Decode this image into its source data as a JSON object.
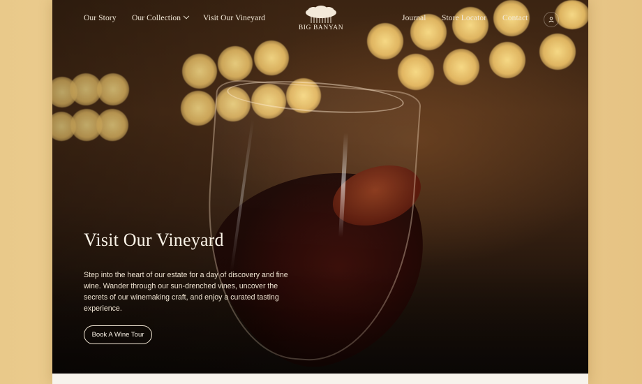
{
  "nav": {
    "left_links": [
      "Our Story",
      "Our Collection",
      "Visit Our Vineyard"
    ],
    "right_links": [
      "Journal",
      "Store Locator",
      "Contact"
    ],
    "logo_text": "BIG BANYAN",
    "icons": {
      "dropdown": "chevron-down-icon",
      "account": "user-icon",
      "logo": "banyan-tree-logo"
    }
  },
  "hero": {
    "title": "Visit Our Vineyard",
    "description": "Step into the heart of our estate for a day of discovery and fine wine. Wander through our sun-drenched vines, uncover the secrets of our winemaking craft, and enjoy a curated tasting experience.",
    "cta_label": "Book A Wine Tour"
  },
  "colors": {
    "page_background": "#eccc90",
    "nav_text": "#f3e9d9",
    "hero_dark": "#1f130b",
    "bokeh": "#fbd98a",
    "wine": "#2a0805"
  }
}
